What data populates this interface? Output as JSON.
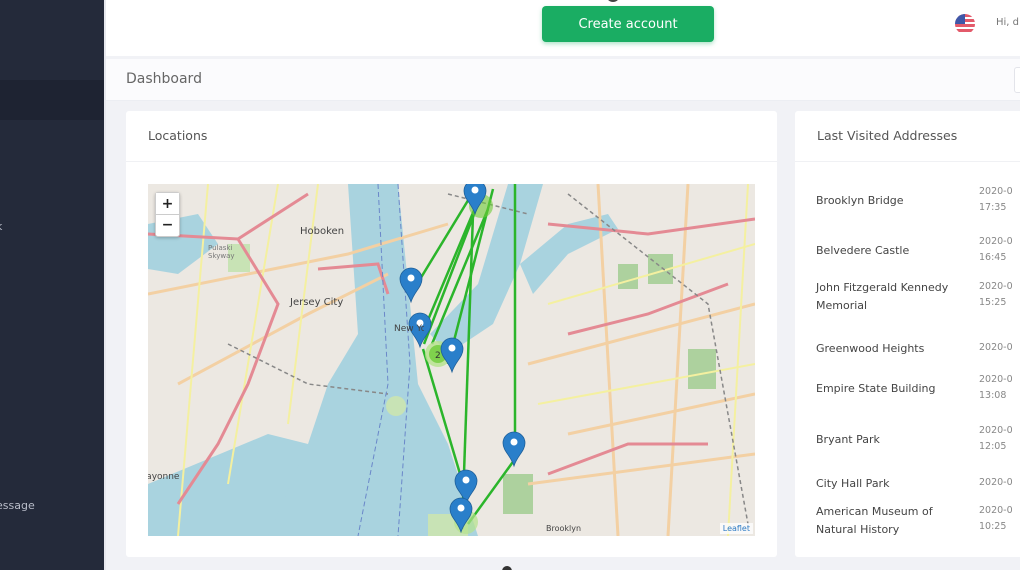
{
  "sidebar": {
    "items": [
      {
        "label": "k"
      },
      {
        "label": "essage"
      }
    ]
  },
  "topbar": {
    "create_account_label": "Create account",
    "greeting": "Hi, d",
    "flag_icon": "us-flag-icon"
  },
  "breadcrumb": {
    "title": "Dashboard"
  },
  "locations_card": {
    "title": "Locations",
    "map": {
      "zoom_in_label": "+",
      "zoom_out_label": "−",
      "attribution": "Leaflet",
      "place_labels": [
        "Hoboken",
        "Jersey City",
        "New York",
        "Brooklyn",
        "Bayonne",
        "Pulaski Skyway"
      ],
      "cluster_count": "2",
      "route_color": "#2bb52b",
      "marker_color": "#2a7fca",
      "marker_count": 7
    }
  },
  "visited_card": {
    "title": "Last Visited Addresses",
    "rows": [
      {
        "name": "Brooklyn Bridge",
        "date": "2020-0",
        "time": "17:35"
      },
      {
        "name": "Belvedere Castle",
        "date": "2020-0",
        "time": "16:45"
      },
      {
        "name": "John Fitzgerald Kennedy Memorial",
        "date": "2020-0",
        "time": "15:25"
      },
      {
        "name": "Greenwood Heights",
        "date": "2020-0",
        "time": ""
      },
      {
        "name": "Empire State Building",
        "date": "2020-0",
        "time": "13:08"
      },
      {
        "name": "Bryant Park",
        "date": "2020-0",
        "time": "12:05"
      },
      {
        "name": "City Hall Park",
        "date": "2020-0",
        "time": ""
      },
      {
        "name": "American Museum of Natural History",
        "date": "2020-0",
        "time": "10:25"
      }
    ]
  }
}
